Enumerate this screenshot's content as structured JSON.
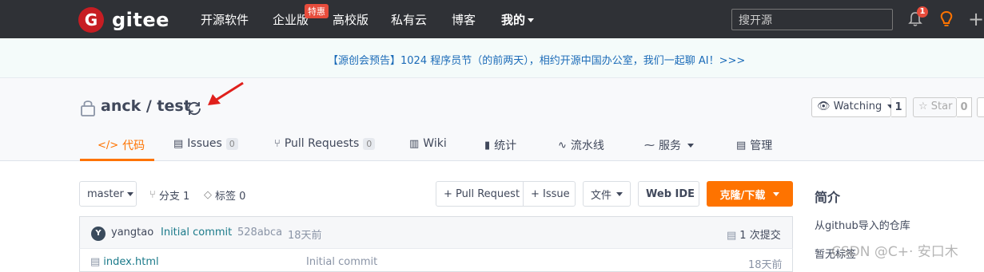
{
  "topnav": {
    "logo_mark": "G",
    "logo_text": "gitee",
    "items": [
      "开源软件",
      "企业版",
      "高校版",
      "私有云",
      "博客"
    ],
    "enterprise_badge": "特惠",
    "mine": "我的",
    "search_placeholder": "搜开源",
    "notification_count": "1",
    "bg_color": "#2f3136",
    "brand_color": "#c71d23"
  },
  "banner": {
    "text": "【源创会预告】1024 程序员节（的前两天），相约开源中国办公室，我们一起聊 AI！>>>"
  },
  "repo": {
    "title": "anck / test",
    "watch_label": "Watching",
    "watch_count": "1",
    "star_label": "Star",
    "star_count": "0"
  },
  "tabs": [
    {
      "icon": "</>",
      "label": "代码",
      "count": ""
    },
    {
      "icon": "▤",
      "label": "Issues",
      "count": "0"
    },
    {
      "icon": "⑂",
      "label": "Pull Requests",
      "count": "0"
    },
    {
      "icon": "▥",
      "label": "Wiki",
      "count": ""
    },
    {
      "icon": "▮",
      "label": "统计",
      "count": ""
    },
    {
      "icon": "∿",
      "label": "流水线",
      "count": ""
    },
    {
      "icon": "⁓",
      "label": "服务",
      "count": ""
    },
    {
      "icon": "▤",
      "label": "管理",
      "count": ""
    }
  ],
  "toolbar": {
    "branch": "master",
    "branches": "分支 1",
    "tags": "标签 0",
    "pull_request": "+ Pull Request",
    "issue": "+ Issue",
    "file": "文件",
    "web_ide": "Web IDE",
    "clone": "克隆/下载",
    "accent_color": "#fe7300"
  },
  "commit": {
    "avatar_letter": "Y",
    "author": "yangtao",
    "message": "Initial commit",
    "hash": "528abca",
    "time": "18天前",
    "count_label": "1 次提交"
  },
  "files": [
    {
      "name": "index.html",
      "message": "Initial commit",
      "time": "18天前"
    }
  ],
  "sidebar": {
    "title": "简介",
    "description": "从github导入的仓库",
    "sub": "暂无标签"
  },
  "watermark": "CSDN @C+· 安口木"
}
